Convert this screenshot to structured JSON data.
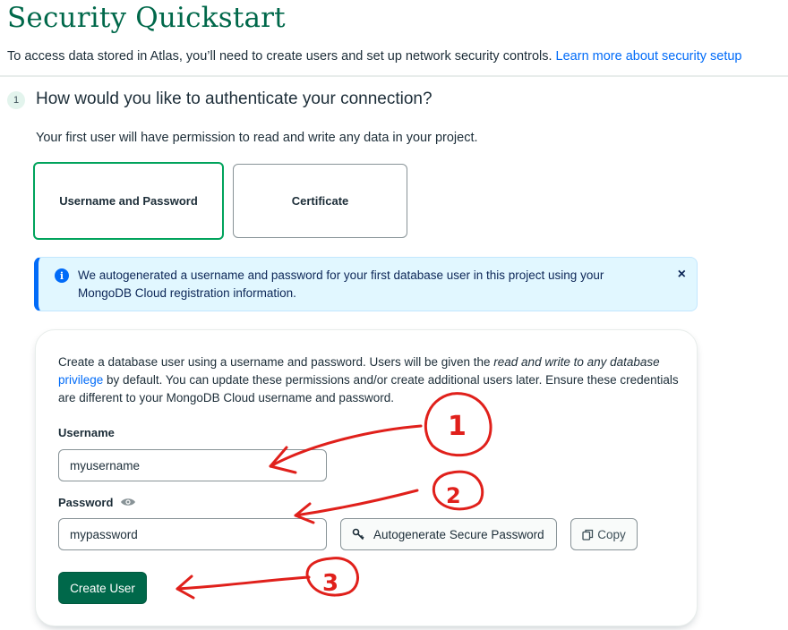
{
  "header": {
    "title": "Security Quickstart",
    "intro": "To access data stored in Atlas, you’ll need to create users and set up network security controls.",
    "intro_link": "Learn more about security setup"
  },
  "step": {
    "number": "1",
    "title": "How would you like to authenticate your connection?",
    "subtitle": "Your first user will have permission to read and write any data in your project."
  },
  "auth_options": {
    "username_password": "Username and Password",
    "certificate": "Certificate"
  },
  "banner": {
    "text": "We autogenerated a username and password for your first database user in this project using your MongoDB Cloud registration information.",
    "info_icon": "i",
    "close": "×"
  },
  "form": {
    "desc_1": "Create a database user using a username and password. Users will be given the ",
    "desc_em": "read and write to any database",
    "desc_link": "privilege",
    "desc_2": " by default. You can update these permissions and/or create additional users later. Ensure these credentials are different to your MongoDB Cloud username and password.",
    "username_label": "Username",
    "username_value": "myusername",
    "password_label": "Password",
    "password_value": "mypassword",
    "autogenerate_label": "Autogenerate Secure Password",
    "copy_label": "Copy",
    "create_label": "Create User"
  },
  "annotations": {
    "mark_1": "1",
    "mark_2": "2",
    "mark_3": "3",
    "color": "#e0201b"
  },
  "colors": {
    "brand_green": "#00684a",
    "link_blue": "#016bf8",
    "selected_border": "#00a35c",
    "banner_bg": "#e1f7ff"
  }
}
